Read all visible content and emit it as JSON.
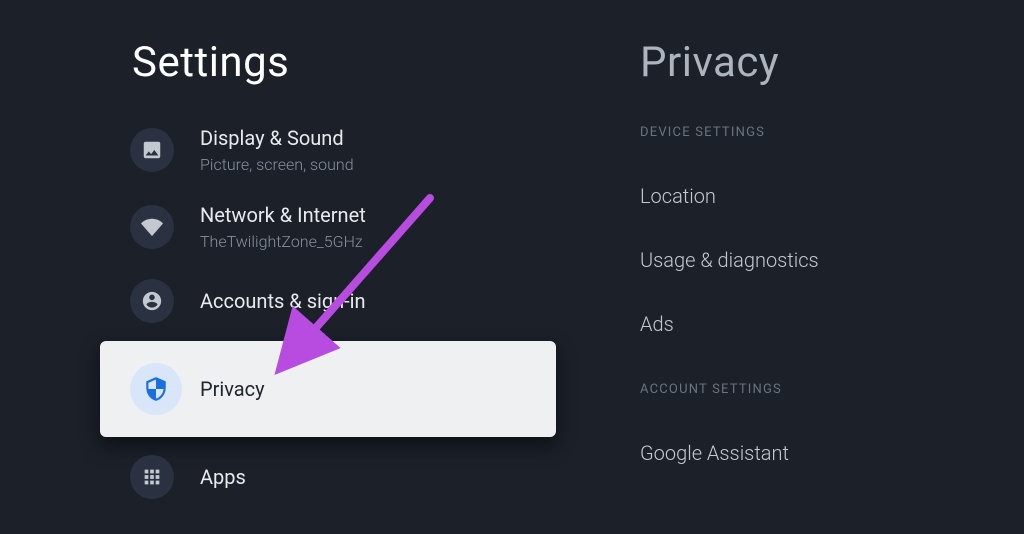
{
  "left": {
    "title": "Settings",
    "items": [
      {
        "label": "Display & Sound",
        "sub": "Picture, screen, sound"
      },
      {
        "label": "Network & Internet",
        "sub": "TheTwilightZone_5GHz"
      },
      {
        "label": "Accounts & sign-in",
        "sub": ""
      },
      {
        "label": "Privacy",
        "sub": ""
      },
      {
        "label": "Apps",
        "sub": ""
      }
    ]
  },
  "right": {
    "title": "Privacy",
    "sections": [
      {
        "header": "DEVICE SETTINGS",
        "items": [
          "Location",
          "Usage & diagnostics",
          "Ads"
        ]
      },
      {
        "header": "ACCOUNT SETTINGS",
        "items": [
          "Google Assistant"
        ]
      }
    ]
  },
  "annotation": {
    "arrow_color": "#b84ce0"
  }
}
